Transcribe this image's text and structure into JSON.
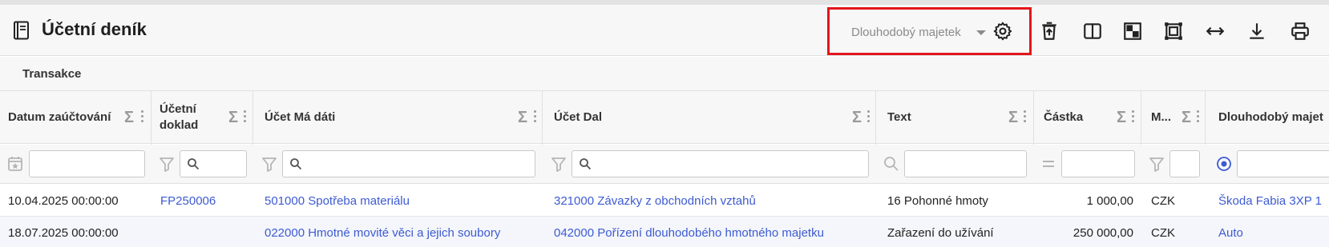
{
  "header": {
    "title": "Účetní deník",
    "title_icon": "book-icon",
    "selected_view": "Dlouhodobý majetek",
    "toolbar_icons": [
      "gear-icon",
      "delete-upload-icon",
      "split-columns-icon",
      "checker-icon",
      "fit-screen-icon",
      "expand-horizontal-icon",
      "download-icon",
      "print-icon"
    ],
    "highlight_color": "#e3161c"
  },
  "tabs": [
    "Transakce"
  ],
  "columns": [
    {
      "label": "Datum zaúčtování",
      "filter_icon": "calendar-icon"
    },
    {
      "label": "Účetní doklad",
      "filter_icon": "filter-icon"
    },
    {
      "label": "Účet Má dáti",
      "filter_icon": "filter-icon"
    },
    {
      "label": "Účet Dal",
      "filter_icon": "filter-icon"
    },
    {
      "label": "Text",
      "filter_icon": "search-icon"
    },
    {
      "label": "Částka",
      "filter_icon": "equals-icon"
    },
    {
      "label": "M...",
      "filter_icon": "filter-icon"
    },
    {
      "label": "Dlouhodobý majet",
      "filter_icon": "radio-icon"
    }
  ],
  "rows": [
    [
      "10.04.2025 00:00:00",
      "FP250006",
      "501000 Spotřeba materiálu",
      "321000 Závazky z obchodních vztahů",
      "16 Pohonné hmoty",
      "1 000,00",
      "CZK",
      "Škoda Fabia 3XP 1"
    ],
    [
      "18.07.2025 00:00:00",
      "",
      "022000 Hmotné movité věci a jejich soubory",
      "042000 Pořízení dlouhodobého hmotného majetku",
      "Zařazení do užívání",
      "250 000,00",
      "CZK",
      "Auto"
    ]
  ],
  "colors": {
    "link": "#3d5bd1",
    "header_bg": "#f7f7f7",
    "alt_row_bg": "#f4f6fb"
  }
}
